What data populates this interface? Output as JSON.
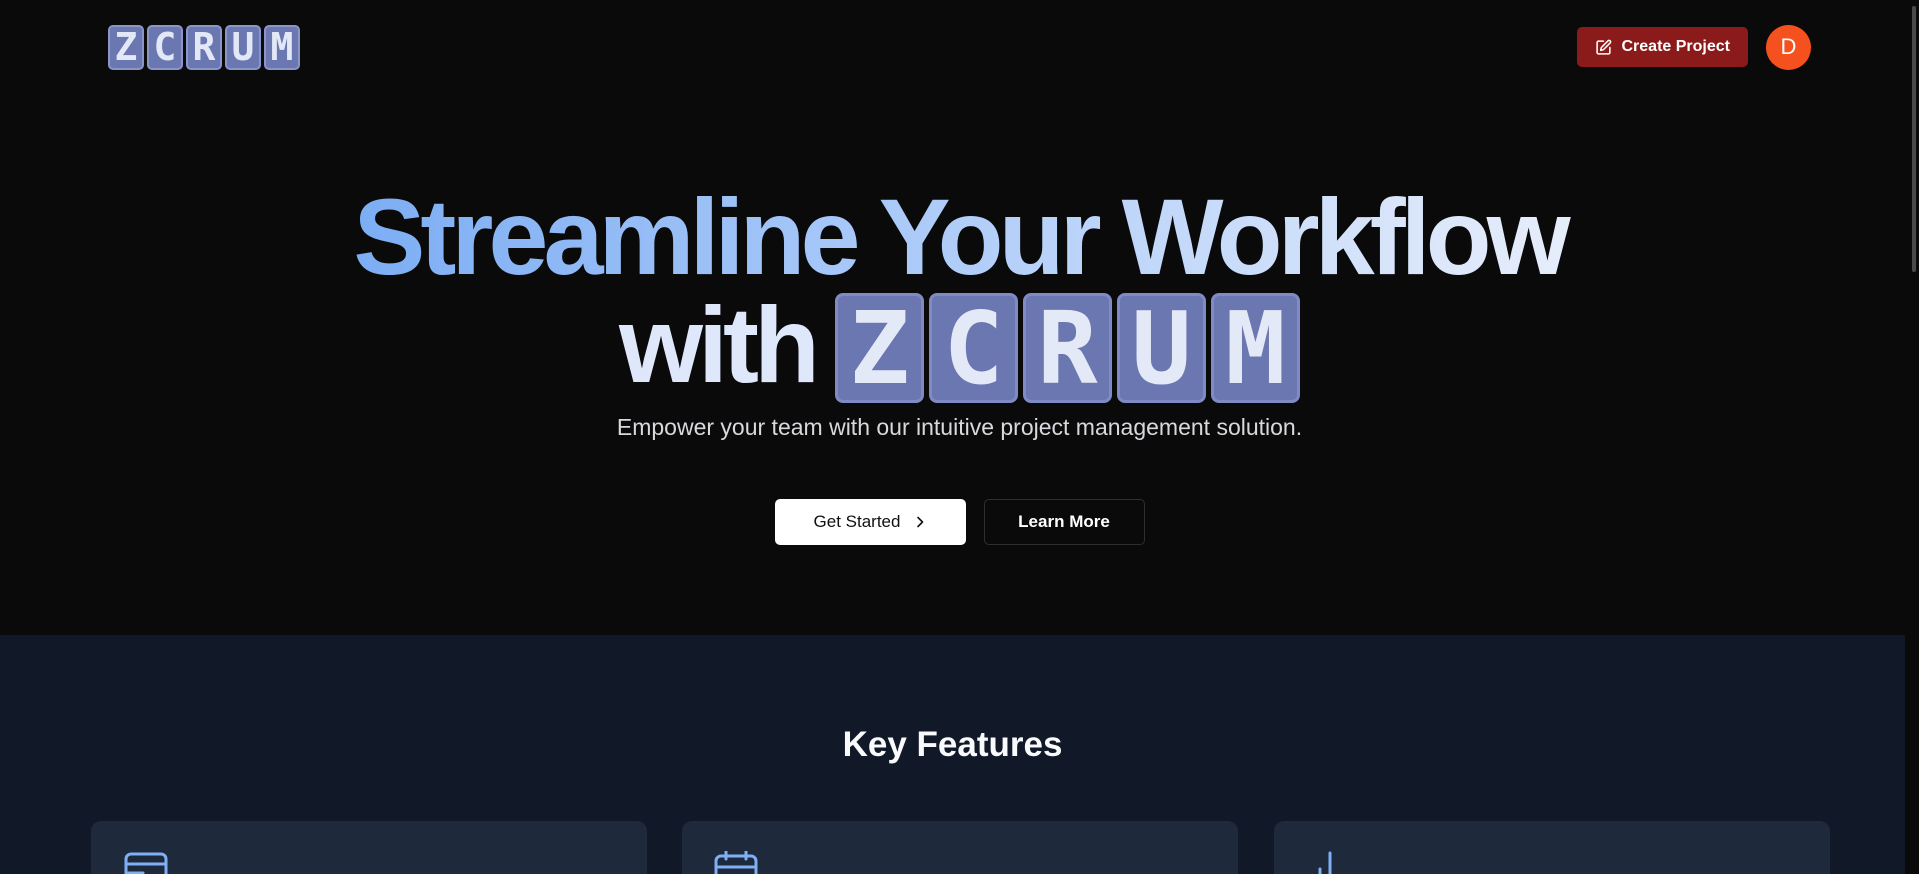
{
  "header": {
    "logo_letters": [
      "Z",
      "C",
      "R",
      "U",
      "M"
    ],
    "create_project_label": "Create Project",
    "avatar_initial": "D"
  },
  "hero": {
    "title_line1": "Streamline Your Workflow",
    "title_with": "with",
    "logo_letters": [
      "Z",
      "C",
      "R",
      "U",
      "M"
    ],
    "subtitle": "Empower your team with our intuitive project management solution.",
    "get_started_label": "Get Started",
    "learn_more_label": "Learn More"
  },
  "features": {
    "title": "Key Features",
    "cards": [
      {
        "icon": "kanban-board-icon"
      },
      {
        "icon": "calendar-icon"
      },
      {
        "icon": "bar-chart-icon"
      }
    ]
  },
  "colors": {
    "background": "#0a0a0b",
    "features_background": "#111827",
    "card_background": "#1e293b",
    "logo_tile": "#6b77b0",
    "create_button": "#8b1a1a",
    "avatar": "#f4511e",
    "accent_blue": "#5e9bf0"
  }
}
